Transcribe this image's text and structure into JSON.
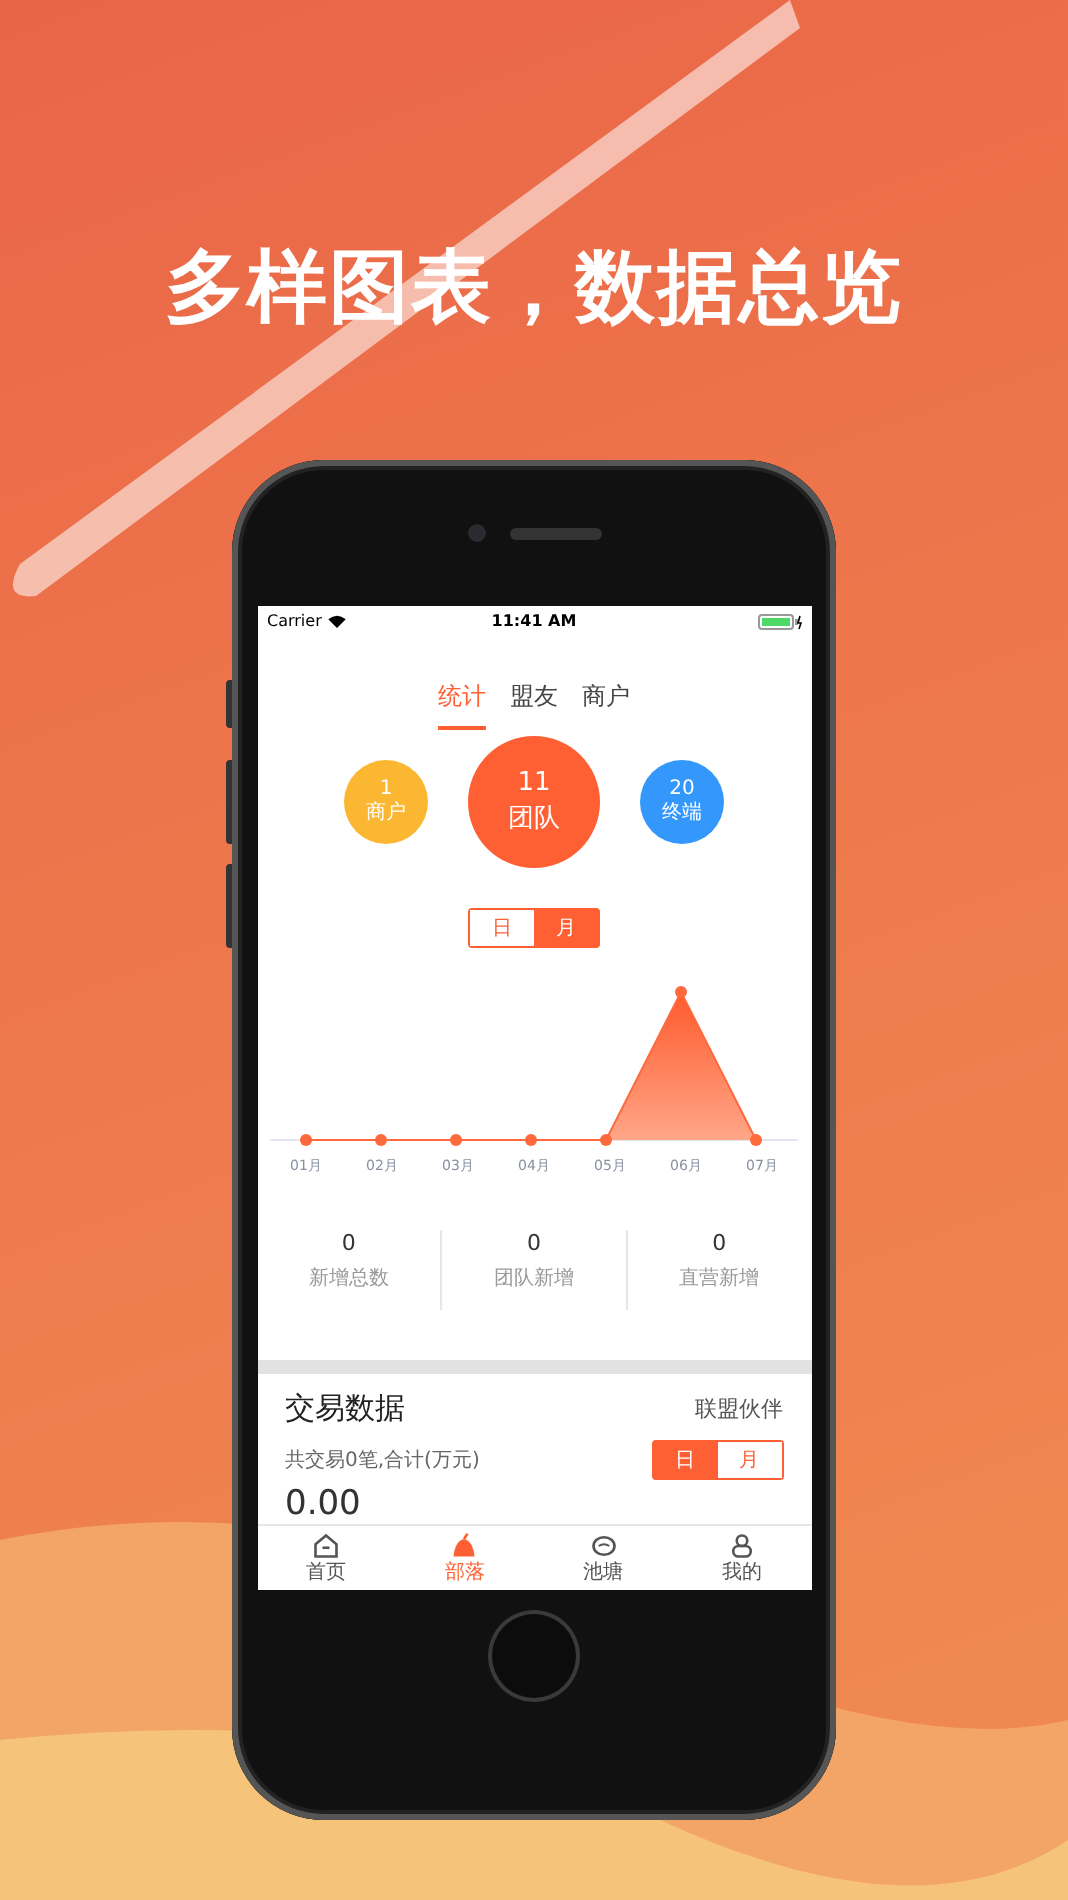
{
  "headline": "多样图表，数据总览",
  "status_bar": {
    "carrier": "Carrier",
    "time": "11:41 AM"
  },
  "tabs": [
    {
      "label": "统计",
      "selected": true
    },
    {
      "label": "盟友",
      "selected": false
    },
    {
      "label": "商户",
      "selected": false
    }
  ],
  "summary": [
    {
      "value": "1",
      "label": "商户",
      "color": "#fbb731",
      "kind": "small"
    },
    {
      "value": "11",
      "label": "团队",
      "color": "#fe5f33",
      "kind": "large"
    },
    {
      "value": "20",
      "label": "终端",
      "color": "#3397fb",
      "kind": "small"
    }
  ],
  "period_toggle": [
    {
      "label": "日",
      "selected": false
    },
    {
      "label": "月",
      "selected": true
    }
  ],
  "chart": {
    "month_labels": [
      "01月",
      "02月",
      "03月",
      "04月",
      "05月",
      "06月",
      "07月"
    ]
  },
  "stats": [
    {
      "value": "0",
      "label": "新增总数"
    },
    {
      "value": "0",
      "label": "团队新增"
    },
    {
      "value": "0",
      "label": "直营新增"
    }
  ],
  "trade": {
    "title": "交易数据",
    "link": "联盟伙伴",
    "summary": "共交易0笔,合计(万元)",
    "toggle": [
      {
        "label": "日",
        "selected": true
      },
      {
        "label": "月",
        "selected": false
      }
    ],
    "amount": "0.00"
  },
  "tab_bar": [
    {
      "label": "首页",
      "selected": false
    },
    {
      "label": "部落",
      "selected": true
    },
    {
      "label": "池塘",
      "selected": false
    },
    {
      "label": "我的",
      "selected": false
    }
  ]
}
